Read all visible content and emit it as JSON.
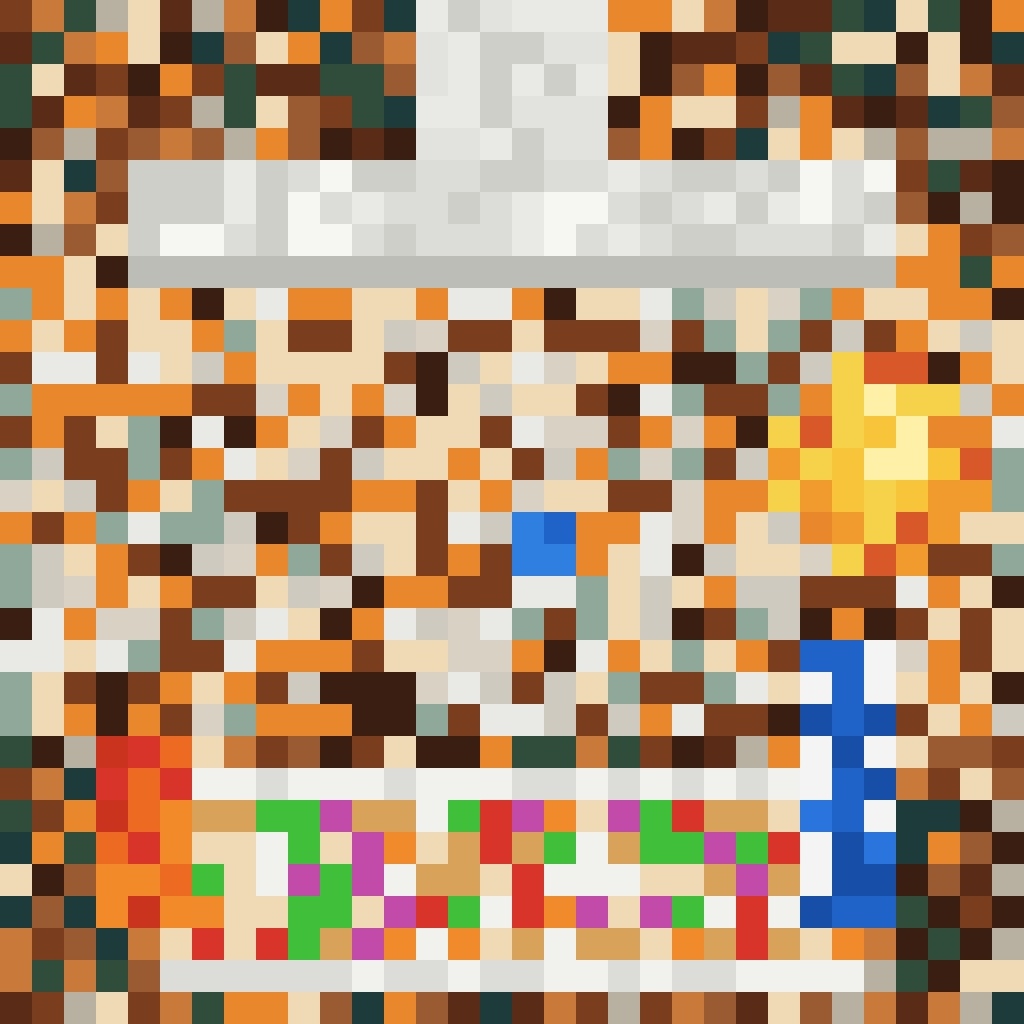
{
  "scene": {
    "description_tag": "pixel-art-kitchen-scene",
    "palette": {
      "wall_brown": "#7a3e1f",
      "dark_brown": "#3b1e12",
      "warm_orange": "#e8872b",
      "fire_yellow": "#f6d24a",
      "hood_white": "#e9e9e6",
      "counter_white": "#f1f1ee",
      "chef_blue": "#1f63c8",
      "chef_white": "#f4f4f4",
      "lettuce_green": "#3fbf3a",
      "tomato_red": "#d8342a",
      "bun_tan": "#d9a25a",
      "cream": "#f0d9b5",
      "teal_dark": "#1d3b3a"
    },
    "block_size": 32
  }
}
